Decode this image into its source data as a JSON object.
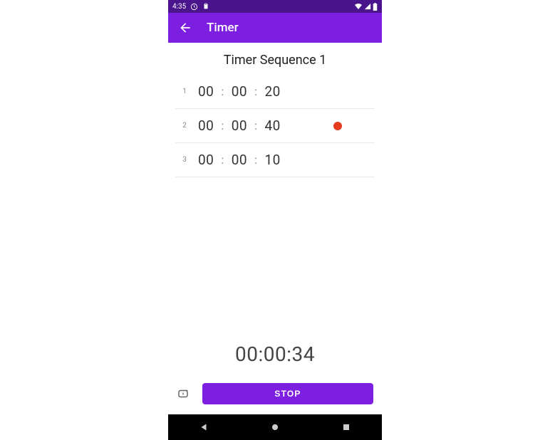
{
  "status_bar": {
    "time": "4:35"
  },
  "app_bar": {
    "title": "Timer"
  },
  "sequence": {
    "title": "Timer Sequence 1",
    "items": [
      {
        "index": "1",
        "hh": "00",
        "mm": "00",
        "ss": "20",
        "active": false
      },
      {
        "index": "2",
        "hh": "00",
        "mm": "00",
        "ss": "40",
        "active": true
      },
      {
        "index": "3",
        "hh": "00",
        "mm": "00",
        "ss": "10",
        "active": false
      }
    ]
  },
  "countdown": {
    "display": "00:00:34"
  },
  "controls": {
    "stop_label": "STOP"
  },
  "colors": {
    "status_dark_purple": "#4a148c",
    "app_bar_purple": "#7c1fe0",
    "accent_purple": "#7c1fe0",
    "active_dot": "#e53a1e"
  }
}
